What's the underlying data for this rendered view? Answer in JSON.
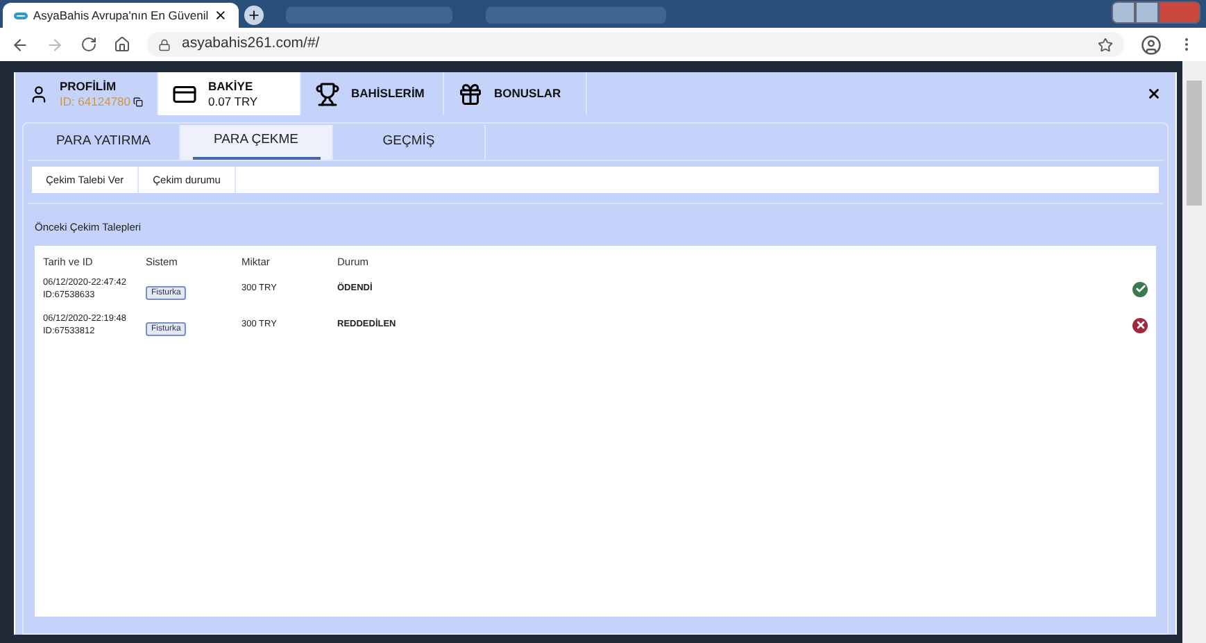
{
  "browser": {
    "tab_title": "AsyaBahis Avrupa'nın En Güvenil",
    "url": "asyabahis261.com/#/"
  },
  "header_tabs": [
    {
      "kind": "profile",
      "title": "PROFİLİM",
      "subtitle": "ID: 64124780",
      "selected": false
    },
    {
      "kind": "balance",
      "title": "BAKİYE",
      "subtitle": "0.07 TRY",
      "selected": true
    },
    {
      "kind": "bets",
      "title": "BAHİSLERİM",
      "selected": false
    },
    {
      "kind": "bonus",
      "title": "BONUSLAR",
      "selected": false
    }
  ],
  "main_tabs": [
    {
      "label": "PARA YATIRMA",
      "selected": false
    },
    {
      "label": "PARA ÇEKME",
      "selected": true
    },
    {
      "label": "GEÇMİŞ",
      "selected": false
    }
  ],
  "sub_tabs": [
    {
      "label": "Çekim Talebi Ver"
    },
    {
      "label": "Çekim durumu"
    }
  ],
  "section_title": "Önceki Çekim Talepleri",
  "table": {
    "columns": [
      "Tarih ve ID",
      "Sistem",
      "Miktar",
      "Durum"
    ],
    "rows": [
      {
        "date": "06/12/2020-22:47:42",
        "id": "ID:67538633",
        "system": "Fisturka",
        "amount": "300 TRY",
        "status": "ÖDENDİ",
        "kind": "paid"
      },
      {
        "date": "06/12/2020-22:19:48",
        "id": "ID:67533812",
        "system": "Fisturka",
        "amount": "300 TRY",
        "status": "REDDEDİLEN",
        "kind": "rejected"
      }
    ]
  }
}
